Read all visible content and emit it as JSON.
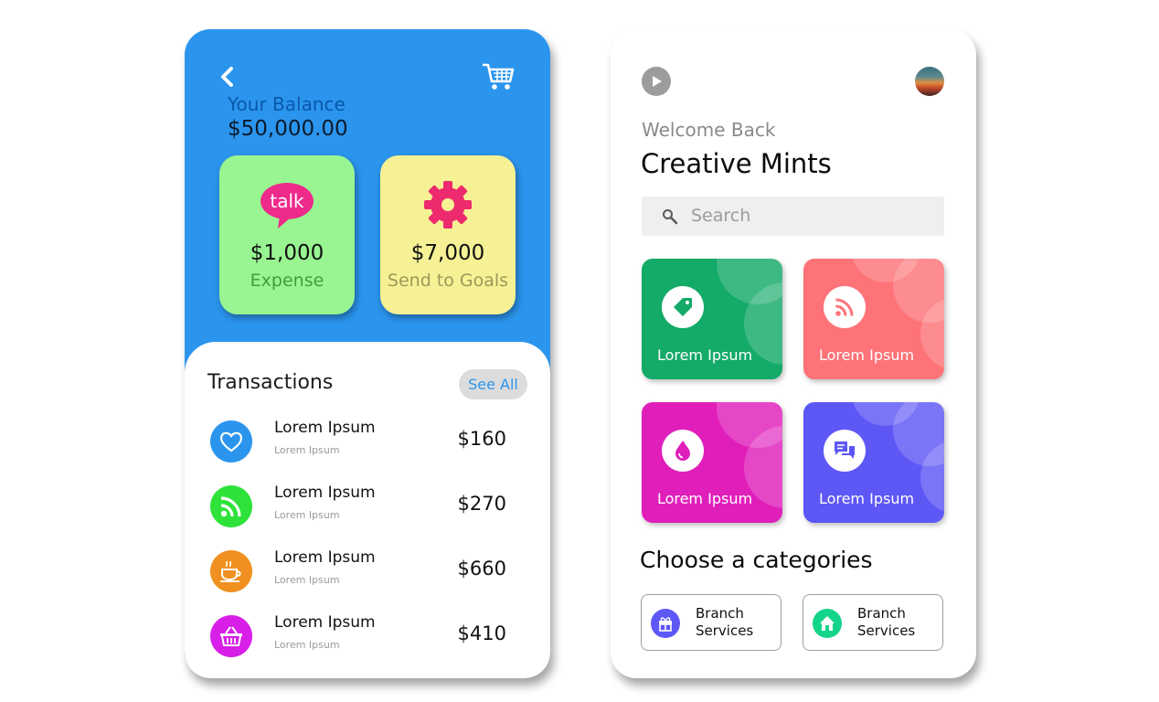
{
  "wallet": {
    "balance_label": "Your Balance",
    "balance_value": "$50,000.00",
    "cards": [
      {
        "icon": "talk-bubble-icon",
        "amount": "$1,000",
        "label": "Expense",
        "color": "#98f591"
      },
      {
        "icon": "gear-icon",
        "amount": "$7,000",
        "label": "Send to Goals",
        "color": "#f6f195"
      }
    ],
    "talk_icon_text": "talk"
  },
  "transactions": {
    "title": "Transactions",
    "see_all_label": "See All",
    "items": [
      {
        "icon": "heart-icon",
        "color": "#2b95ee",
        "name": "Lorem Ipsum",
        "sub": "Lorem Ipsum",
        "amount": "$160"
      },
      {
        "icon": "rss-icon",
        "color": "#2ee23a",
        "name": "Lorem Ipsum",
        "sub": "Lorem Ipsum",
        "amount": "$270"
      },
      {
        "icon": "coffee-cup-icon",
        "color": "#f09020",
        "name": "Lorem Ipsum",
        "sub": "Lorem Ipsum",
        "amount": "$660"
      },
      {
        "icon": "basket-icon",
        "color": "#d81fe8",
        "name": "Lorem Ipsum",
        "sub": "Lorem Ipsum",
        "amount": "$410"
      }
    ]
  },
  "home": {
    "welcome": "Welcome Back",
    "user_name": "Creative Mints",
    "search_placeholder": "Search",
    "tiles": [
      {
        "icon": "tag-icon",
        "label": "Lorem Ipsum",
        "color": "#14aa68"
      },
      {
        "icon": "rss-icon",
        "label": "Lorem Ipsum",
        "color": "#fd7378"
      },
      {
        "icon": "drop-icon",
        "label": "Lorem Ipsum",
        "color": "#e01fbb"
      },
      {
        "icon": "chat-icon",
        "label": "Lorem Ipsum",
        "color": "#5d57f6"
      }
    ],
    "categories_title": "Choose a categories",
    "categories": [
      {
        "icon": "gift-icon",
        "label_line1": "Branch",
        "label_line2": "Services",
        "color": "#5d57f6"
      },
      {
        "icon": "home-icon",
        "label_line1": "Branch",
        "label_line2": "Services",
        "color": "#14d48a"
      }
    ]
  }
}
